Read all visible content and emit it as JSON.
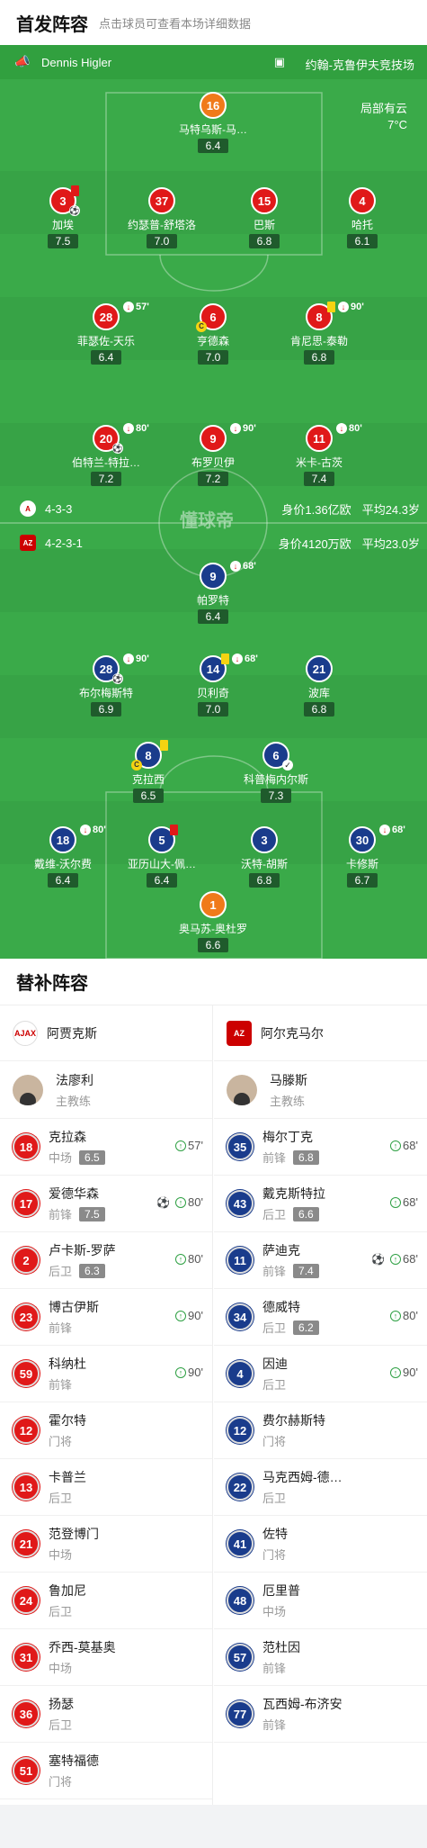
{
  "header": {
    "title": "首发阵容",
    "subtitle": "点击球员可查看本场详细数据"
  },
  "pitch": {
    "referee": "Dennis Higler",
    "venue": "约翰-克鲁伊夫竞技场",
    "weather": "局部有云",
    "temperature": "7°C",
    "center_logo": "懂球帝",
    "home": {
      "formation": "4-3-3",
      "value": "身价1.36亿欧",
      "age": "平均24.3岁"
    },
    "away": {
      "formation": "4-2-3-1",
      "value": "身价4120万欧",
      "age": "平均23.0岁"
    }
  },
  "home_players": [
    {
      "num": "16",
      "name": "马特乌斯-马…",
      "rating": "6.4"
    },
    {
      "num": "3",
      "name": "加埃",
      "rating": "7.5"
    },
    {
      "num": "37",
      "name": "约瑟普-舒塔洛",
      "rating": "7.0"
    },
    {
      "num": "15",
      "name": "巴斯",
      "rating": "6.8"
    },
    {
      "num": "4",
      "name": "哈托",
      "rating": "6.1"
    },
    {
      "num": "28",
      "name": "菲瑟佐-天乐",
      "rating": "6.4",
      "sub": "57'"
    },
    {
      "num": "6",
      "name": "亨德森",
      "rating": "7.0"
    },
    {
      "num": "8",
      "name": "肯尼思-泰勒",
      "rating": "6.8",
      "sub": "90'"
    },
    {
      "num": "20",
      "name": "伯特兰-特拉…",
      "rating": "7.2",
      "sub": "80'"
    },
    {
      "num": "9",
      "name": "布罗贝伊",
      "rating": "7.2",
      "sub": "90'"
    },
    {
      "num": "11",
      "name": "米卡-古茨",
      "rating": "7.4",
      "sub": "80'"
    }
  ],
  "away_players": [
    {
      "num": "9",
      "name": "帕罗特",
      "rating": "6.4",
      "sub": "68'"
    },
    {
      "num": "28",
      "name": "布尔梅斯特",
      "rating": "6.9",
      "sub": "90'"
    },
    {
      "num": "14",
      "name": "贝利奇",
      "rating": "7.0",
      "sub": "68'"
    },
    {
      "num": "21",
      "name": "波库",
      "rating": "6.8"
    },
    {
      "num": "8",
      "name": "克拉西",
      "rating": "6.5"
    },
    {
      "num": "6",
      "name": "科普梅内尔斯",
      "rating": "7.3"
    },
    {
      "num": "18",
      "name": "戴维-沃尔费",
      "rating": "6.4",
      "sub": "80'"
    },
    {
      "num": "5",
      "name": "亚历山大-佩…",
      "rating": "6.4"
    },
    {
      "num": "3",
      "name": "沃特-胡斯",
      "rating": "6.8"
    },
    {
      "num": "30",
      "name": "卡修斯",
      "rating": "6.7",
      "sub": "68'"
    },
    {
      "num": "1",
      "name": "奥马苏-奥杜罗",
      "rating": "6.6"
    }
  ],
  "subs": {
    "title": "替补阵容",
    "home": {
      "team": "阿贾克斯",
      "logo": "AJAX",
      "coach": {
        "name": "法廖利",
        "role": "主教练"
      },
      "players": [
        {
          "num": "18",
          "name": "克拉森",
          "pos": "中场",
          "rating": "6.5",
          "min": "57'"
        },
        {
          "num": "17",
          "name": "爱德华森",
          "pos": "前锋",
          "rating": "7.5",
          "min": "80'",
          "goal": "⚽"
        },
        {
          "num": "2",
          "name": "卢卡斯-罗萨",
          "pos": "后卫",
          "rating": "6.3",
          "min": "80'"
        },
        {
          "num": "23",
          "name": "博古伊斯",
          "pos": "前锋",
          "min": "90'"
        },
        {
          "num": "59",
          "name": "科纳杜",
          "pos": "前锋",
          "min": "90'"
        },
        {
          "num": "12",
          "name": "霍尔特",
          "pos": "门将"
        },
        {
          "num": "13",
          "name": "卡普兰",
          "pos": "后卫"
        },
        {
          "num": "21",
          "name": "范登博门",
          "pos": "中场"
        },
        {
          "num": "24",
          "name": "鲁加尼",
          "pos": "后卫"
        },
        {
          "num": "31",
          "name": "乔西-莫基奥",
          "pos": "中场"
        },
        {
          "num": "36",
          "name": "扬瑟",
          "pos": "后卫"
        },
        {
          "num": "51",
          "name": "塞特福德",
          "pos": "门将"
        }
      ]
    },
    "away": {
      "team": "阿尔克马尔",
      "logo": "AZ",
      "coach": {
        "name": "马滕斯",
        "role": "主教练"
      },
      "players": [
        {
          "num": "35",
          "name": "梅尔丁克",
          "pos": "前锋",
          "rating": "6.8",
          "min": "68'"
        },
        {
          "num": "43",
          "name": "戴克斯特拉",
          "pos": "后卫",
          "rating": "6.6",
          "min": "68'"
        },
        {
          "num": "11",
          "name": "萨迪克",
          "pos": "前锋",
          "rating": "7.4",
          "min": "68'",
          "goal": "⚽"
        },
        {
          "num": "34",
          "name": "德威特",
          "pos": "后卫",
          "rating": "6.2",
          "min": "80'"
        },
        {
          "num": "4",
          "name": "因迪",
          "pos": "后卫",
          "min": "90'"
        },
        {
          "num": "12",
          "name": "费尔赫斯特",
          "pos": "门将"
        },
        {
          "num": "22",
          "name": "马克西姆-德…",
          "pos": "后卫"
        },
        {
          "num": "41",
          "name": "佐特",
          "pos": "门将"
        },
        {
          "num": "48",
          "name": "厄里普",
          "pos": "中场"
        },
        {
          "num": "57",
          "name": "范杜因",
          "pos": "前锋"
        },
        {
          "num": "77",
          "name": "瓦西姆-布济安",
          "pos": "前锋"
        }
      ]
    }
  }
}
